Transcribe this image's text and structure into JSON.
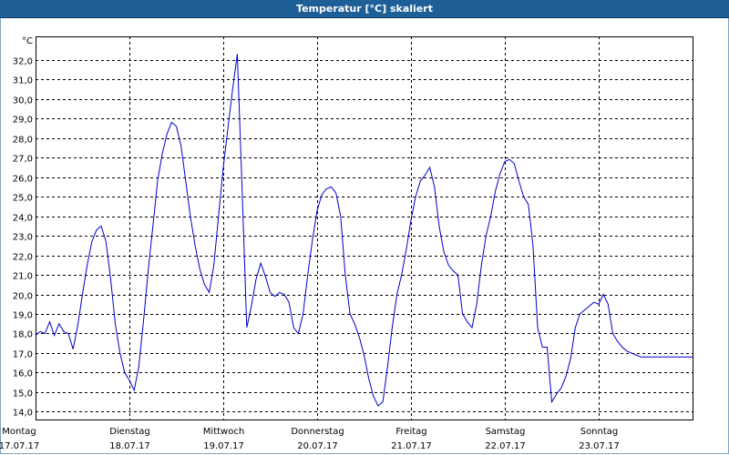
{
  "title": "Temperatur [°C] skaliert",
  "colors": {
    "titlebar": "#1d5f96",
    "line": "#0000cc",
    "grid": "#000000"
  },
  "chart_data": {
    "type": "line",
    "title": "Temperatur [°C] skaliert",
    "yunit": "°C",
    "xlabel": "",
    "ylabel": "",
    "ylim": [
      13.6,
      33.2
    ],
    "grid": true,
    "yticks": [
      "14,0",
      "15,0",
      "16,0",
      "17,0",
      "18,0",
      "19,0",
      "20,0",
      "21,0",
      "22,0",
      "23,0",
      "24,0",
      "25,0",
      "26,0",
      "27,0",
      "28,0",
      "29,0",
      "30,0",
      "31,0",
      "32,0"
    ],
    "days": [
      {
        "day": "Montag",
        "date": "17.07.17"
      },
      {
        "day": "Dienstag",
        "date": "18.07.17"
      },
      {
        "day": "Mittwoch",
        "date": "19.07.17"
      },
      {
        "day": "Donnerstag",
        "date": "20.07.17"
      },
      {
        "day": "Freitag",
        "date": "21.07.17"
      },
      {
        "day": "Samstag",
        "date": "22.07.17"
      },
      {
        "day": "Sonntag",
        "date": "23.07.17"
      }
    ],
    "series": [
      {
        "x": [
          0,
          0.05,
          0.1,
          0.15,
          0.2,
          0.25,
          0.3,
          0.35,
          0.4,
          0.45,
          0.5,
          0.55,
          0.6,
          0.65,
          0.7,
          0.75,
          0.8,
          0.85,
          0.9,
          0.95,
          1.0,
          1.05,
          1.1,
          1.15,
          1.2,
          1.25,
          1.3,
          1.35,
          1.4,
          1.45,
          1.5,
          1.55,
          1.6,
          1.65,
          1.7,
          1.75,
          1.8,
          1.85,
          1.9,
          1.95,
          2.0,
          2.05,
          2.1,
          2.15,
          2.2,
          2.25,
          2.3,
          2.35,
          2.4,
          2.45,
          2.5,
          2.55,
          2.6,
          2.65,
          2.7,
          2.75,
          2.8,
          2.85,
          2.9,
          2.95,
          3.0,
          3.05,
          3.1,
          3.15,
          3.2,
          3.25,
          3.3,
          3.35,
          3.4,
          3.45,
          3.5,
          3.55,
          3.6,
          3.65,
          3.7,
          3.75,
          3.8,
          3.85,
          3.9,
          3.95,
          4.0,
          4.05,
          4.1,
          4.15,
          4.2,
          4.25,
          4.3,
          4.35,
          4.4,
          4.45,
          4.5,
          4.55,
          4.6,
          4.65,
          4.7,
          4.75,
          4.8,
          4.85,
          4.9,
          4.95,
          5.0,
          5.05,
          5.1,
          5.15,
          5.2,
          5.25,
          5.3,
          5.35,
          5.4,
          5.45,
          5.5,
          5.55,
          5.6,
          5.65,
          5.7,
          5.75,
          5.8,
          5.85,
          5.9,
          5.95,
          6.0,
          6.05,
          6.1,
          6.15,
          6.2,
          6.25,
          6.3,
          6.35,
          6.4,
          6.45,
          6.5,
          6.55,
          6.6,
          6.65,
          6.7,
          6.75,
          6.8,
          6.85,
          6.9,
          6.95,
          7.0
        ],
        "y": [
          17.9,
          18.1,
          18.0,
          18.6,
          17.9,
          18.5,
          18.1,
          18.0,
          17.2,
          18.4,
          20.0,
          21.5,
          22.7,
          23.3,
          23.5,
          22.7,
          20.8,
          18.5,
          17.0,
          16.0,
          15.6,
          15.1,
          16.3,
          18.6,
          21.2,
          23.5,
          25.8,
          27.2,
          28.2,
          28.8,
          28.6,
          27.6,
          25.8,
          24.0,
          22.5,
          21.3,
          20.5,
          20.1,
          21.5,
          24.0,
          26.5,
          28.5,
          30.5,
          32.3,
          25.5,
          18.3,
          19.4,
          20.8,
          21.6,
          20.9,
          20.1,
          19.9,
          20.1,
          20.0,
          19.6,
          18.3,
          18.0,
          19.0,
          21.0,
          22.8,
          24.3,
          25.1,
          25.4,
          25.5,
          25.2,
          24.0,
          21.0,
          19.0,
          18.5,
          17.8,
          16.9,
          15.7,
          14.8,
          14.3,
          14.5,
          16.3,
          18.3,
          20.0,
          21.0,
          22.3,
          23.8,
          25.0,
          25.8,
          26.1,
          26.5,
          25.5,
          23.5,
          22.2,
          21.5,
          21.2,
          21.0,
          19.0,
          18.6,
          18.3,
          19.5,
          21.5,
          23.0,
          24.0,
          25.3,
          26.2,
          26.8,
          26.9,
          26.7,
          25.8,
          25.0,
          24.6,
          22.5,
          18.3,
          17.3,
          17.3,
          14.5,
          14.9,
          15.2,
          15.8,
          16.7,
          18.3,
          19.0,
          19.2,
          19.4,
          19.6,
          19.5,
          20.0,
          19.5,
          18.0,
          17.6,
          17.3,
          17.1,
          17.0,
          16.9,
          16.8,
          16.8,
          16.8,
          16.8,
          16.8,
          16.8,
          16.8,
          16.8,
          16.8,
          16.8,
          16.8,
          16.8
        ]
      }
    ]
  }
}
